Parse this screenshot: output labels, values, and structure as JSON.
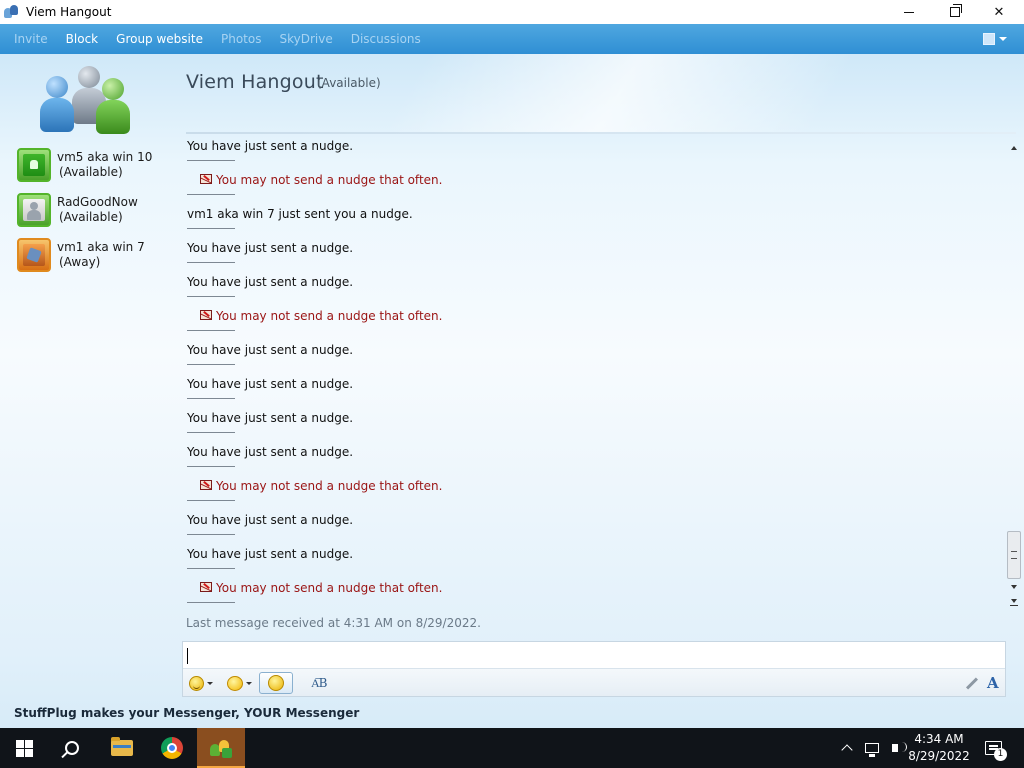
{
  "window": {
    "title": "Viem Hangout",
    "controls": {
      "minimize": "minimize",
      "restore": "restore",
      "close": "close"
    }
  },
  "menubar": {
    "items": [
      {
        "label": "Invite",
        "enabled": false
      },
      {
        "label": "Block",
        "enabled": true
      },
      {
        "label": "Group website",
        "enabled": true
      },
      {
        "label": "Photos",
        "enabled": false
      },
      {
        "label": "SkyDrive",
        "enabled": false
      },
      {
        "label": "Discussions",
        "enabled": false
      }
    ]
  },
  "conversation": {
    "title": "Viem Hangout",
    "status": "(Available)"
  },
  "contacts": [
    {
      "name": "vm5 aka win 10",
      "status": "(Available)",
      "presence": "available",
      "icon": "android-icon"
    },
    {
      "name": "RadGoodNow",
      "status": "(Available)",
      "presence": "available",
      "icon": "default-user-icon"
    },
    {
      "name": "vm1 aka win 7",
      "status": "(Away)",
      "presence": "away",
      "icon": "photo-icon"
    }
  ],
  "messages": [
    {
      "type": "normal",
      "text": "You have just sent a nudge."
    },
    {
      "type": "error",
      "text": "You may not send a nudge that often."
    },
    {
      "type": "normal",
      "text": "vm1 aka win 7 just sent you a nudge."
    },
    {
      "type": "normal",
      "text": "You have just sent a nudge."
    },
    {
      "type": "normal",
      "text": "You have just sent a nudge."
    },
    {
      "type": "error",
      "text": "You may not send a nudge that often."
    },
    {
      "type": "normal",
      "text": "You have just sent a nudge."
    },
    {
      "type": "normal",
      "text": "You have just sent a nudge."
    },
    {
      "type": "normal",
      "text": "You have just sent a nudge."
    },
    {
      "type": "normal",
      "text": "You have just sent a nudge."
    },
    {
      "type": "error",
      "text": "You may not send a nudge that often."
    },
    {
      "type": "normal",
      "text": "You have just sent a nudge."
    },
    {
      "type": "normal",
      "text": "You have just sent a nudge."
    },
    {
      "type": "error",
      "text": "You may not send a nudge that often."
    }
  ],
  "last_message": "Last message received at 4:31 AM on 8/29/2022.",
  "input": {
    "value": ""
  },
  "input_toolbar": {
    "emoticon": "smiley-icon",
    "wink": "wink-icon",
    "nudge": "nudge-icon",
    "spellcheck": "A͞B",
    "font": "A"
  },
  "promo": "StuffPlug makes your Messenger, YOUR Messenger",
  "taskbar": {
    "clock_time": "4:34 AM",
    "clock_date": "8/29/2022",
    "notification_count": "1",
    "accent_color": "#f6a742"
  },
  "colors": {
    "menubar": "#2f8fd4",
    "error_text": "#9a1414",
    "available": "#53b42a",
    "away": "#e08a1e"
  }
}
